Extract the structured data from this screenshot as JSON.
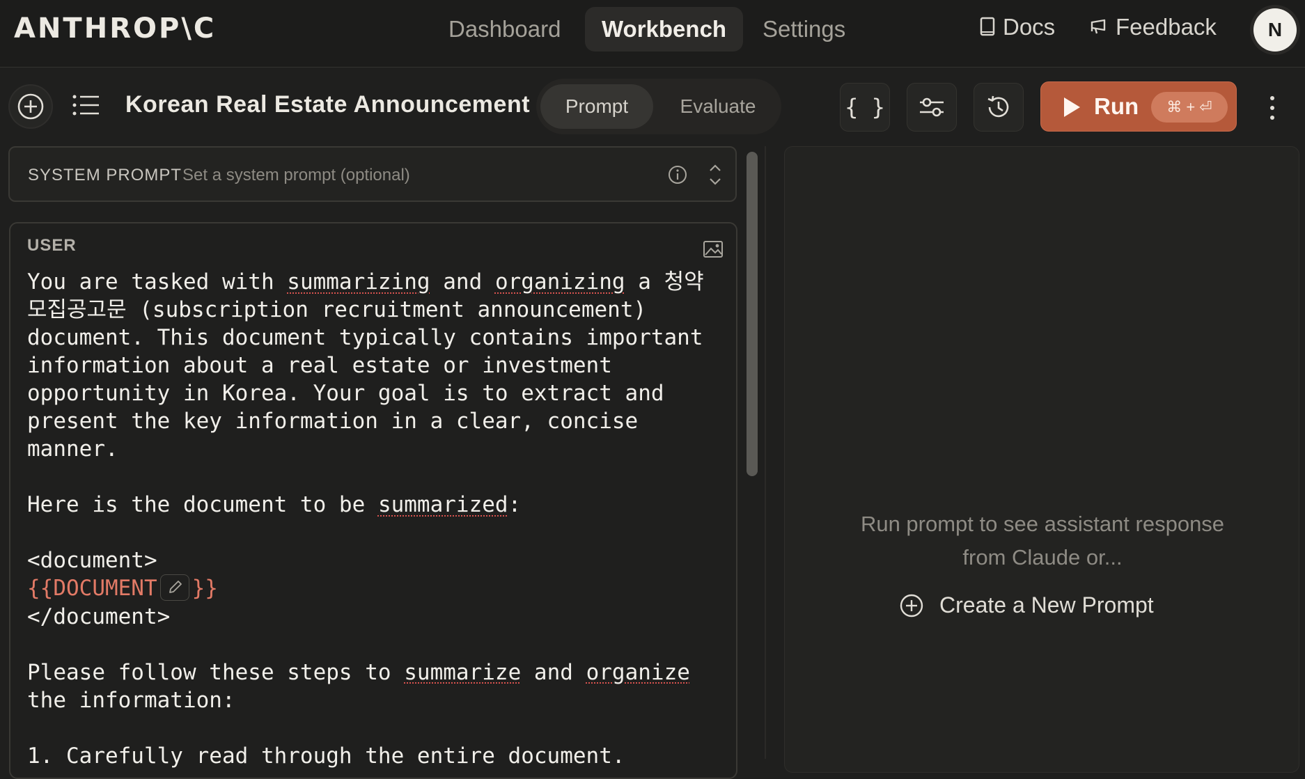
{
  "topnav": {
    "logo": "ANTHROP\\C",
    "tabs": [
      {
        "label": "Dashboard",
        "active": false
      },
      {
        "label": "Workbench",
        "active": true
      },
      {
        "label": "Settings",
        "active": false
      }
    ],
    "docs_label": "Docs",
    "feedback_label": "Feedback",
    "avatar_initial": "N"
  },
  "toolbar": {
    "prompt_title": "Korean Real Estate Announcement Summary",
    "modes": {
      "prompt": "Prompt",
      "evaluate": "Evaluate"
    },
    "run_label": "Run",
    "run_shortcut": "⌘ + ⏎"
  },
  "system_prompt": {
    "label": "SYSTEM PROMPT",
    "placeholder": "Set a system prompt (optional)"
  },
  "user_message": {
    "role_label": "USER",
    "variable": "{{DOCUMENT"
  },
  "response": {
    "hint": "Run prompt to see assistant response from Claude or...",
    "new_prompt_label": "Create a New Prompt"
  },
  "colors": {
    "accent": "#b5593a",
    "variable": "#e27a66",
    "background": "#1f1f1e"
  }
}
